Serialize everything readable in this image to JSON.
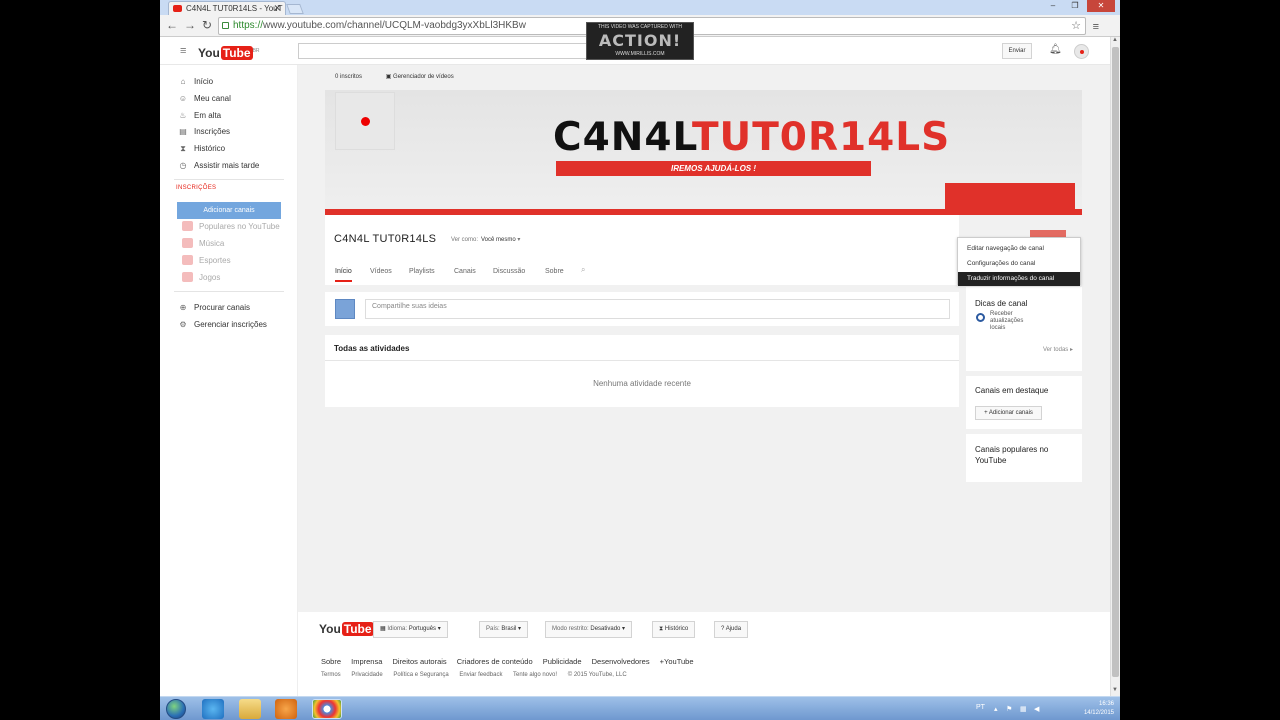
{
  "browser": {
    "tab_title": "C4N4L TUT0R14LS - YouT",
    "url_scheme": "https://",
    "url_rest": "www.youtube.com/channel/UCQLM-vaobdg3yxXbLl3HKBw"
  },
  "watermark": {
    "line1": "THIS VIDEO WAS CAPTURED WITH",
    "logo": "ACTION!",
    "line2": "WWW.MIRILLIS.COM"
  },
  "header": {
    "logo_you": "You",
    "logo_tube": "Tube",
    "logo_region": "BR",
    "upload_label": "Enviar"
  },
  "sidebar": {
    "items": [
      {
        "label": "Início",
        "icon": "home-icon"
      },
      {
        "label": "Meu canal",
        "icon": "user-icon"
      },
      {
        "label": "Em alta",
        "icon": "flame-icon"
      },
      {
        "label": "Inscrições",
        "icon": "subscriptions-icon"
      },
      {
        "label": "Histórico",
        "icon": "hourglass-icon"
      },
      {
        "label": "Assistir mais tarde",
        "icon": "clock-icon"
      }
    ],
    "section_label": "INSCRIÇÕES",
    "add_channels": "Adicionar canais",
    "suggestions": [
      "Populares no YouTube",
      "Música",
      "Esportes",
      "Jogos"
    ],
    "bottom_items": [
      {
        "label": "Procurar canais",
        "icon": "plus-circle-icon"
      },
      {
        "label": "Gerenciar inscrições",
        "icon": "gear-icon"
      }
    ]
  },
  "channel": {
    "subscribers": "0 inscritos",
    "video_manager": "Gerenciador de vídeos",
    "banner_title_black": "C4N4L",
    "banner_title_red": "TUT0R14LS",
    "banner_subtitle": "IREMOS AJUDÁ-LOS !",
    "name": "C4N4L TUT0R14LS",
    "view_as_label": "Ver como:",
    "view_as_value": "Você mesmo",
    "tabs": [
      "Início",
      "Vídeos",
      "Playlists",
      "Canais",
      "Discussão",
      "Sobre"
    ],
    "share_placeholder": "Compartilhe suas ideias",
    "activity_title": "Todas as atividades",
    "activity_empty": "Nenhuma atividade recente"
  },
  "context_menu": {
    "items": [
      "Editar navegação de canal",
      "Configurações do canal",
      "Traduzir informações do canal"
    ]
  },
  "right_column": {
    "tips_title": "Dicas de canal",
    "tips_item": "Receber atualizações locais",
    "see_all": "Ver todas",
    "featured_title": "Canais em destaque",
    "featured_add": "+ Adicionar canais",
    "popular_title": "Canais populares no YouTube"
  },
  "footer": {
    "logo_you": "You",
    "logo_tube": "Tube",
    "language_label": "Idioma:",
    "language_value": "Português",
    "country_label": "País:",
    "country_value": "Brasil",
    "restricted_label": "Modo restrito:",
    "restricted_value": "Desativado",
    "history": "Histórico",
    "help": "Ajuda",
    "links": [
      "Sobre",
      "Imprensa",
      "Direitos autorais",
      "Criadores de conteúdo",
      "Publicidade",
      "Desenvolvedores",
      "+YouTube"
    ],
    "small_links": [
      "Termos",
      "Privacidade",
      "Política e Segurança",
      "Enviar feedback",
      "Tente algo novo!",
      "© 2015 YouTube, LLC"
    ]
  },
  "taskbar": {
    "language": "PT",
    "time": "16:36",
    "date": "14/12/2015"
  },
  "colors": {
    "brand_red": "#e62117",
    "banner_red": "#e0312a",
    "add_channels_blue": "#73a6de"
  }
}
